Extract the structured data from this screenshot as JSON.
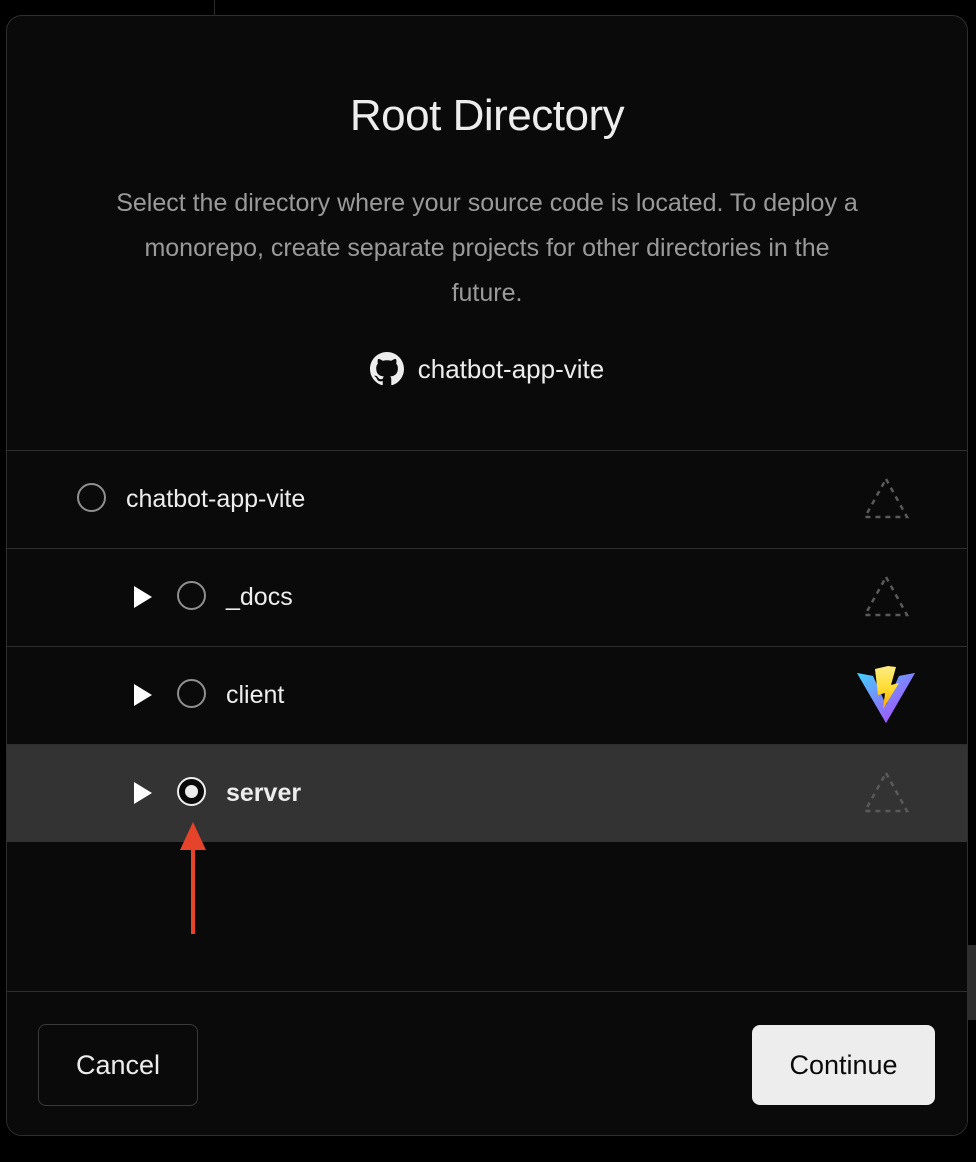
{
  "dialog": {
    "title": "Root Directory",
    "description": "Select the directory where your source code is located. To deploy a monorepo, create separate projects for other directories in the future.",
    "repository": {
      "icon": "github-icon",
      "name": "chatbot-app-vite"
    }
  },
  "directories": [
    {
      "label": "chatbot-app-vite",
      "expandable": false,
      "selected": false,
      "framework_icon": "unknown-framework-icon"
    },
    {
      "label": "_docs",
      "expandable": true,
      "selected": false,
      "framework_icon": "unknown-framework-icon"
    },
    {
      "label": "client",
      "expandable": true,
      "selected": false,
      "framework_icon": "vite-icon"
    },
    {
      "label": "server",
      "expandable": true,
      "selected": true,
      "framework_icon": "unknown-framework-icon"
    }
  ],
  "footer": {
    "cancel_label": "Cancel",
    "continue_label": "Continue"
  },
  "annotation": {
    "icon": "red-arrow-icon",
    "color": "#e5432a"
  },
  "colors": {
    "selected_row_bg": "#333333",
    "modal_bg": "#0a0a0a",
    "primary_button_bg": "#ededed"
  }
}
